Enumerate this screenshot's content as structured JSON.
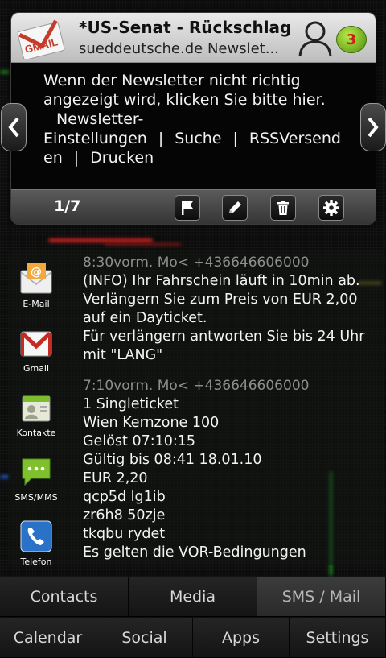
{
  "email_widget": {
    "subject": "*US-Senat - Rückschlag f...",
    "sender": "sueddeutsche.de Newslet...",
    "unread_count": "3",
    "body": {
      "line1": "Wenn der Newsletter nicht richtig",
      "line2": "angezeigt wird, klicken Sie bitte hier.",
      "line3": "Newsletter-",
      "link_settings": "Einstellungen",
      "separator": "|",
      "link_search": "Suche",
      "link_rss_a": "RSSVersend",
      "link_rss_b": "en",
      "link_print": "Drucken"
    },
    "page_indicator": "1/7",
    "actions": [
      "flag-icon",
      "edit-icon",
      "trash-icon",
      "gear-icon"
    ]
  },
  "apps": [
    {
      "label": "E-Mail",
      "icon": "email-app-icon"
    },
    {
      "label": "Gmail",
      "icon": "gmail-app-icon"
    },
    {
      "label": "Kontakte",
      "icon": "contacts-app-icon"
    },
    {
      "label": "SMS/MMS",
      "icon": "sms-app-icon"
    },
    {
      "label": "Telefon",
      "icon": "phone-app-icon"
    }
  ],
  "sms": [
    {
      "meta": "8:30vorm. Mo< +436646606000",
      "text": "(INFO) Ihr Fahrschein läuft in 10min ab. Verlängern Sie zum Preis von EUR 2,00 auf ein Dayticket.\nFür verlängern antworten Sie bis 24 Uhr mit \"LANG\""
    },
    {
      "meta": "7:10vorm. Mo< +436646606000",
      "text": "1 Singleticket\nWien Kernzone 100\nGelöst 07:10:15\nGültig bis 08:41 18.01.10\nEUR 2,20\nqcp5d lg1ib\nzr6h8 50zje\ntkqbu rydet\nEs gelten die VOR-Bedingungen"
    }
  ],
  "nav": {
    "row1": [
      "Contacts",
      "Media",
      "SMS / Mail"
    ],
    "row2": [
      "Calendar",
      "Social",
      "Apps",
      "Settings"
    ],
    "active": "SMS / Mail"
  },
  "colors": {
    "badge": "#5fa312",
    "badge_text": "#d21a1a",
    "sms_meta": "#8e8e8e"
  }
}
